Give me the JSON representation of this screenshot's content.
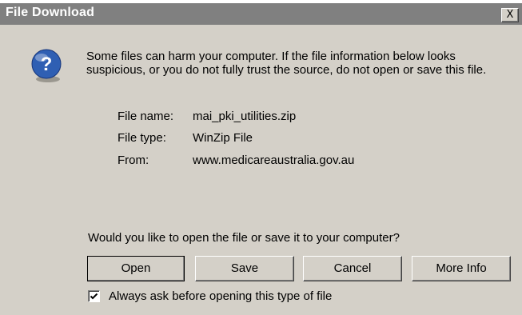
{
  "window": {
    "title": "File Download",
    "close_label": "X"
  },
  "icon": "question-icon",
  "message": "Some files can harm your computer. If the file information below looks suspicious, or you do not fully trust the source, do not open or save this file.",
  "file_info": {
    "name_label": "File name:",
    "name_value": "mai_pki_utilities.zip",
    "type_label": "File type:",
    "type_value": "WinZip File",
    "from_label": "From:",
    "from_value": "www.medicareaustralia.gov.au"
  },
  "question": "Would you like to open the file or save it to your computer?",
  "buttons": {
    "open": "Open",
    "save": "Save",
    "cancel": "Cancel",
    "more_info": "More Info"
  },
  "checkbox": {
    "label": "Always ask before opening this type of file",
    "checked": true
  },
  "colors": {
    "titlebar": "#808080",
    "face": "#d4d0c8",
    "icon_blue": "#2f5fb3"
  }
}
